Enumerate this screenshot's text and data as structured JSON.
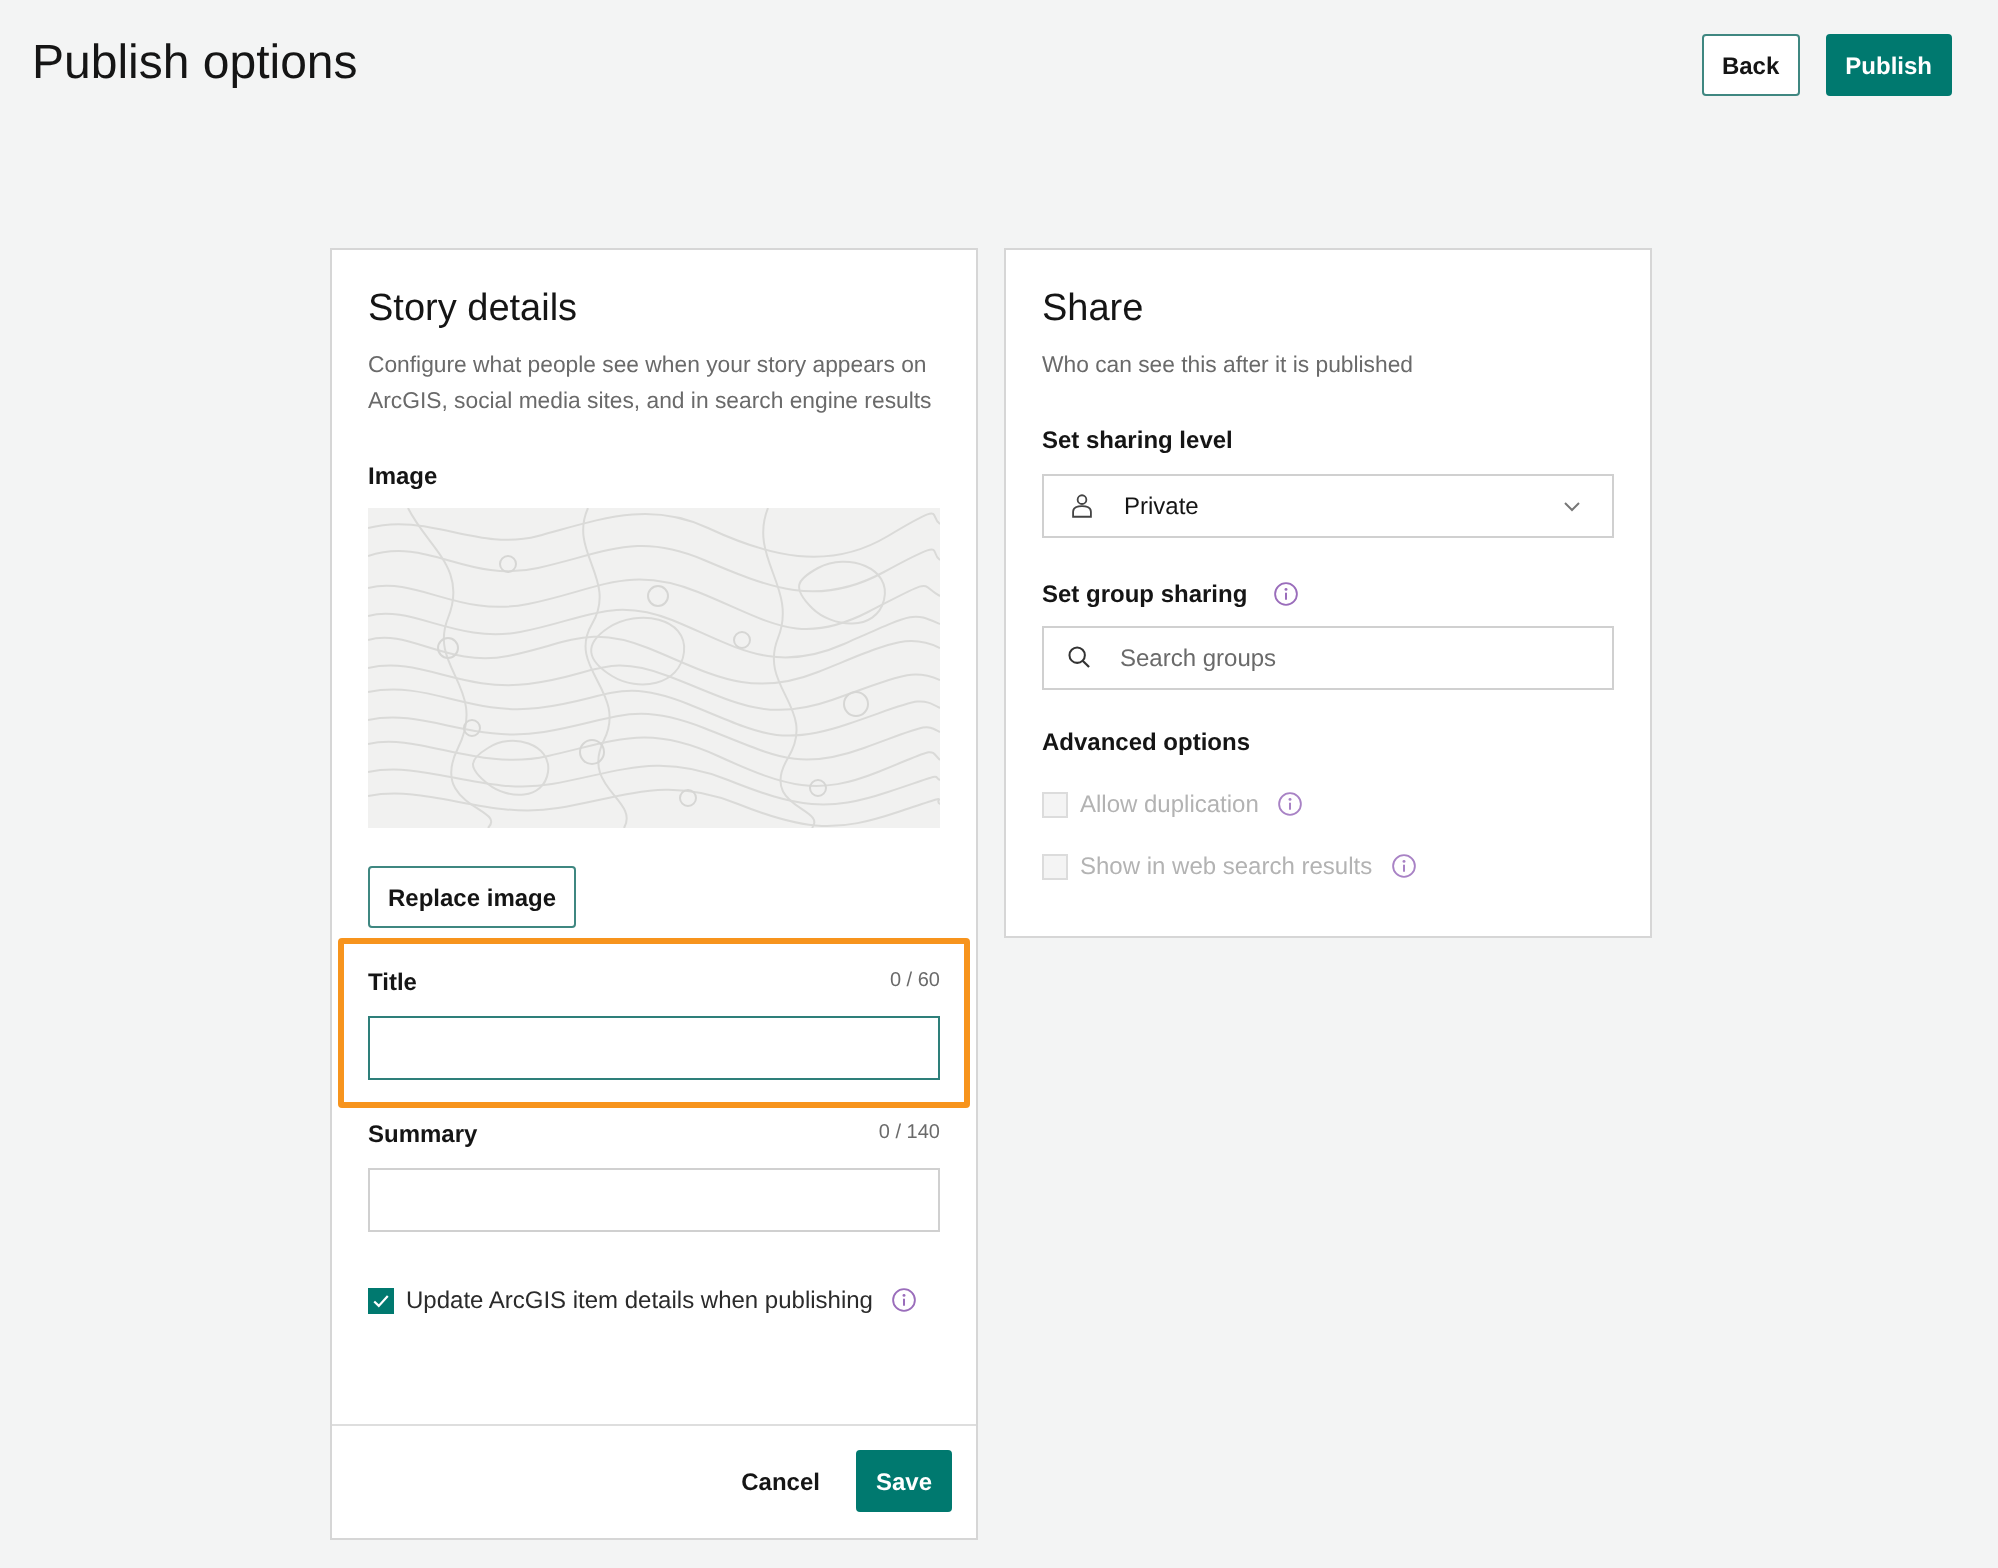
{
  "header": {
    "title": "Publish options",
    "buttons": [
      {
        "label": "Back",
        "kind": "outline"
      },
      {
        "label": "Publish",
        "kind": "primary"
      }
    ]
  },
  "story_details": {
    "title": "Story details",
    "description": "Configure what people see when your story appears on ArcGIS, social media sites, and in search engine results",
    "image": {
      "label": "Image",
      "button": "Replace image"
    },
    "fields": [
      {
        "label": "Title",
        "counter": "0 / 60",
        "focused": true,
        "highlighted": true
      },
      {
        "label": "Summary",
        "counter": "0 / 140",
        "focused": false,
        "highlighted": false
      }
    ],
    "checkbox": {
      "label": "Update ArcGIS item details when publishing",
      "checked": true,
      "info": true
    },
    "footer_buttons": [
      {
        "label": "Cancel",
        "kind": "text"
      },
      {
        "label": "Save",
        "kind": "primary"
      }
    ]
  },
  "share": {
    "title": "Share",
    "description": "Who can see this after it is published",
    "sharing_level": {
      "label": "Set sharing level",
      "value": "Private"
    },
    "group_sharing": {
      "label": "Set group sharing",
      "info": true,
      "placeholder": "Search groups"
    },
    "advanced": {
      "label": "Advanced options",
      "options": [
        {
          "label": "Allow duplication",
          "checked": false,
          "disabled": true,
          "info": true
        },
        {
          "label": "Show in web search results",
          "checked": false,
          "disabled": true,
          "info": true
        }
      ]
    }
  }
}
